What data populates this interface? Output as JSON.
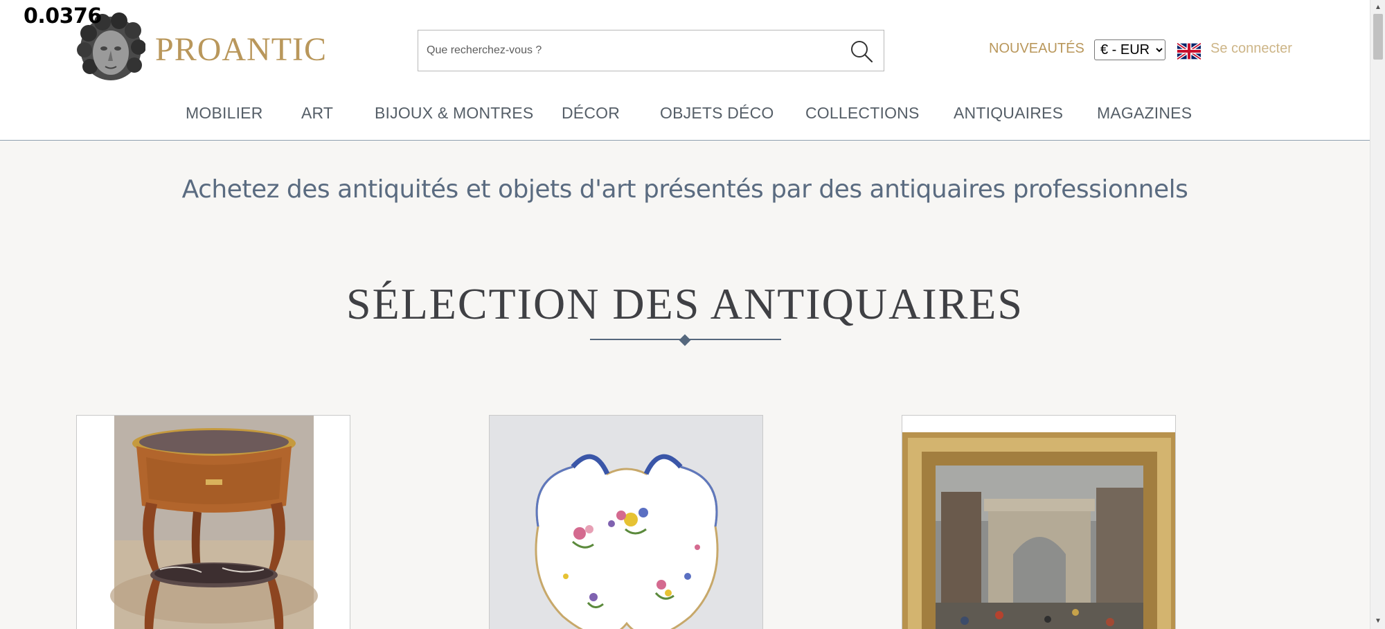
{
  "overlay_text": "0.0376",
  "logo": {
    "text": "PROANTIC",
    "icon": "medusa-head-icon"
  },
  "search": {
    "placeholder": "Que recherchez-vous ?",
    "value": "",
    "icon": "search-icon"
  },
  "header_links": {
    "nouveautes": "NOUVEAUTÉS",
    "connect": "Se connecter",
    "flag_icon": "uk-flag-icon"
  },
  "currency": {
    "selected": "€ - EUR"
  },
  "nav": [
    {
      "label": "MOBILIER"
    },
    {
      "label": "ART"
    },
    {
      "label": "BIJOUX & MONTRES"
    },
    {
      "label": "DÉCOR"
    },
    {
      "label": "OBJETS DÉCO"
    },
    {
      "label": "COLLECTIONS"
    },
    {
      "label": "ANTIQUAIRES"
    },
    {
      "label": "MAGAZINES"
    }
  ],
  "tagline": "Achetez des antiquités et objets d'art présentés par des antiquaires professionnels",
  "section": {
    "title": "SÉLECTION DES ANTIQUAIRES"
  },
  "cards": [
    {
      "image": "marquetry-gueridon-table"
    },
    {
      "image": "porcelain-shell-dish"
    },
    {
      "image": "framed-paris-painting"
    }
  ],
  "colors": {
    "gold": "#b9975b",
    "nav_text": "#555e67",
    "tagline": "#5a6b80",
    "accent_line": "#55677d",
    "background": "#f7f6f4"
  }
}
